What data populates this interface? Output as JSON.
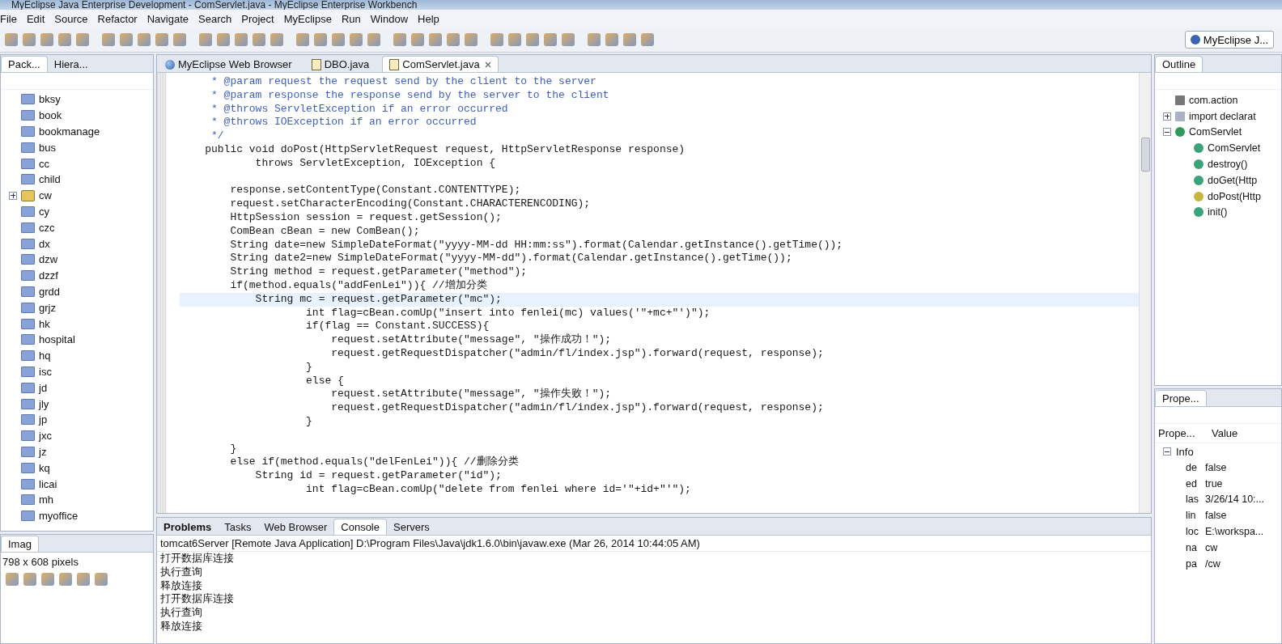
{
  "window": {
    "title": "MyEclipse Java Enterprise Development - ComServlet.java - MyEclipse Enterprise Workbench"
  },
  "menu": [
    "File",
    "Edit",
    "Source",
    "Refactor",
    "Navigate",
    "Search",
    "Project",
    "MyEclipse",
    "Run",
    "Window",
    "Help"
  ],
  "perspective": {
    "label": "MyEclipse J..."
  },
  "package_explorer": {
    "tabs": [
      {
        "label": "Pack...",
        "selected": true
      },
      {
        "label": "Hiera...",
        "selected": false
      }
    ],
    "items": [
      {
        "label": "bksy",
        "kind": "folder"
      },
      {
        "label": "book",
        "kind": "folder"
      },
      {
        "label": "bookmanage",
        "kind": "folder"
      },
      {
        "label": "bus",
        "kind": "folder"
      },
      {
        "label": "cc",
        "kind": "folder"
      },
      {
        "label": "child",
        "kind": "folder"
      },
      {
        "label": "cw",
        "kind": "project"
      },
      {
        "label": "cy",
        "kind": "folder"
      },
      {
        "label": "czc",
        "kind": "folder"
      },
      {
        "label": "dx",
        "kind": "folder"
      },
      {
        "label": "dzw",
        "kind": "folder"
      },
      {
        "label": "dzzf",
        "kind": "folder"
      },
      {
        "label": "grdd",
        "kind": "folder"
      },
      {
        "label": "grjz",
        "kind": "folder"
      },
      {
        "label": "hk",
        "kind": "folder"
      },
      {
        "label": "hospital",
        "kind": "folder"
      },
      {
        "label": "hq",
        "kind": "folder"
      },
      {
        "label": "isc",
        "kind": "folder"
      },
      {
        "label": "jd",
        "kind": "folder"
      },
      {
        "label": "jly",
        "kind": "folder"
      },
      {
        "label": "jp",
        "kind": "folder"
      },
      {
        "label": "jxc",
        "kind": "folder"
      },
      {
        "label": "jz",
        "kind": "folder"
      },
      {
        "label": "kq",
        "kind": "folder"
      },
      {
        "label": "licai",
        "kind": "folder"
      },
      {
        "label": "mh",
        "kind": "folder"
      },
      {
        "label": "myoffice",
        "kind": "folder"
      }
    ]
  },
  "image_view": {
    "tab": "Imag",
    "size": "798 x 608 pixels"
  },
  "editor": {
    "tabs": [
      {
        "label": "MyEclipse Web Browser",
        "kind": "browser",
        "selected": false
      },
      {
        "label": "DBO.java",
        "kind": "java",
        "selected": false
      },
      {
        "label": "ComServlet.java",
        "kind": "java",
        "selected": true
      }
    ],
    "lines": [
      {
        "kind": "comment",
        "text": "     * @param request the request send by the client to the server",
        "current": false
      },
      {
        "kind": "comment",
        "text": "     * @param response the response send by the server to the client",
        "current": false
      },
      {
        "kind": "comment",
        "text": "     * @throws ServletException if an error occurred",
        "current": false
      },
      {
        "kind": "comment",
        "text": "     * @throws IOException if an error occurred",
        "current": false
      },
      {
        "kind": "comment",
        "text": "     */",
        "current": false
      },
      {
        "kind": "code",
        "text": "    public void doPost(HttpServletRequest request, HttpServletResponse response)",
        "current": false
      },
      {
        "kind": "code",
        "text": "            throws ServletException, IOException {",
        "current": false
      },
      {
        "kind": "blank",
        "current": false
      },
      {
        "kind": "code",
        "text": "        response.setContentType(Constant.CONTENTTYPE);",
        "current": false
      },
      {
        "kind": "code",
        "text": "        request.setCharacterEncoding(Constant.CHARACTERENCODING);",
        "current": false
      },
      {
        "kind": "code",
        "text": "        HttpSession session = request.getSession();",
        "current": false
      },
      {
        "kind": "code",
        "text": "        ComBean cBean = new ComBean();",
        "current": false
      },
      {
        "kind": "code",
        "text": "        String date=new SimpleDateFormat(\"yyyy-MM-dd HH:mm:ss\").format(Calendar.getInstance().getTime());",
        "current": false
      },
      {
        "kind": "code",
        "text": "        String date2=new SimpleDateFormat(\"yyyy-MM-dd\").format(Calendar.getInstance().getTime());",
        "current": false
      },
      {
        "kind": "code",
        "text": "        String method = request.getParameter(\"method\");",
        "current": false
      },
      {
        "kind": "code",
        "text": "        if(method.equals(\"addFenLei\")){ //增加分类",
        "current": false
      },
      {
        "kind": "code",
        "text": "            String mc = request.getParameter(\"mc\");",
        "current": true
      },
      {
        "kind": "code",
        "text": "                    int flag=cBean.comUp(\"insert into fenlei(mc) values('\"+mc+\"')\");",
        "current": false
      },
      {
        "kind": "code",
        "text": "                    if(flag == Constant.SUCCESS){",
        "current": false
      },
      {
        "kind": "code",
        "text": "                        request.setAttribute(\"message\", \"操作成功！\");",
        "current": false
      },
      {
        "kind": "code",
        "text": "                        request.getRequestDispatcher(\"admin/fl/index.jsp\").forward(request, response);",
        "current": false
      },
      {
        "kind": "code",
        "text": "                    }",
        "current": false
      },
      {
        "kind": "code",
        "text": "                    else {",
        "current": false
      },
      {
        "kind": "code",
        "text": "                        request.setAttribute(\"message\", \"操作失败！\");",
        "current": false
      },
      {
        "kind": "code",
        "text": "                        request.getRequestDispatcher(\"admin/fl/index.jsp\").forward(request, response);",
        "current": false
      },
      {
        "kind": "code",
        "text": "                    }",
        "current": false
      },
      {
        "kind": "blank",
        "current": false
      },
      {
        "kind": "code",
        "text": "        }",
        "current": false
      },
      {
        "kind": "code",
        "text": "        else if(method.equals(\"delFenLei\")){ //删除分类",
        "current": false
      },
      {
        "kind": "code",
        "text": "            String id = request.getParameter(\"id\");",
        "current": false
      },
      {
        "kind": "code",
        "text": "                    int flag=cBean.comUp(\"delete from fenlei where id='\"+id+\"'\");",
        "current": false
      }
    ]
  },
  "bottom_panel": {
    "tabs": [
      {
        "label": "Problems",
        "selected": false,
        "emphasized": true
      },
      {
        "label": "Tasks",
        "selected": false,
        "emphasized": false
      },
      {
        "label": "Web Browser",
        "selected": false,
        "emphasized": false
      },
      {
        "label": "Console",
        "selected": true,
        "emphasized": false
      },
      {
        "label": "Servers",
        "selected": false,
        "emphasized": false
      }
    ],
    "console_title": "tomcat6Server [Remote Java Application] D:\\Program Files\\Java\\jdk1.6.0\\bin\\javaw.exe (Mar 26, 2014 10:44:05 AM)",
    "output": [
      "打开数据库连接",
      "执行查询",
      "释放连接",
      "打开数据库连接",
      "执行查询",
      "释放连接"
    ]
  },
  "outline": {
    "tab": "Outline",
    "items": [
      {
        "label": "com.action",
        "kind": "package"
      },
      {
        "label": "import declarat",
        "kind": "imports",
        "expanded": false
      },
      {
        "label": "ComServlet",
        "kind": "class",
        "expanded": true,
        "children": [
          {
            "label": "ComServlet",
            "kind": "constructor"
          },
          {
            "label": "destroy()",
            "kind": "method"
          },
          {
            "label": "doGet(Http",
            "kind": "method"
          },
          {
            "label": "doPost(Http",
            "kind": "edited-method"
          },
          {
            "label": "init()",
            "kind": "method"
          }
        ]
      }
    ]
  },
  "properties": {
    "tab": "Prope...",
    "columns": [
      "Prope...",
      "Value"
    ],
    "group": "Info",
    "rows": [
      {
        "key": "de",
        "value": "false"
      },
      {
        "key": "ed",
        "value": "true"
      },
      {
        "key": "las",
        "value": "3/26/14 10:..."
      },
      {
        "key": "lin",
        "value": "false"
      },
      {
        "key": "loc",
        "value": "E:\\workspa..."
      },
      {
        "key": "na",
        "value": "cw"
      },
      {
        "key": "pa",
        "value": "/cw"
      }
    ]
  }
}
